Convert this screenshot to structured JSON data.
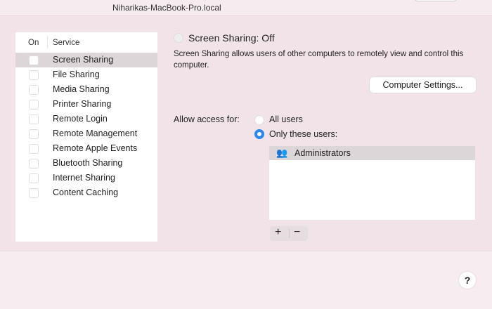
{
  "window": {
    "hostname": "Niharikas-MacBook-Pro.local"
  },
  "services": {
    "col_on": "On",
    "col_service": "Service",
    "items": [
      {
        "label": "Screen Sharing",
        "on": false,
        "selected": true
      },
      {
        "label": "File Sharing",
        "on": false
      },
      {
        "label": "Media Sharing",
        "on": false
      },
      {
        "label": "Printer Sharing",
        "on": false
      },
      {
        "label": "Remote Login",
        "on": false
      },
      {
        "label": "Remote Management",
        "on": false
      },
      {
        "label": "Remote Apple Events",
        "on": false
      },
      {
        "label": "Bluetooth Sharing",
        "on": false
      },
      {
        "label": "Internet Sharing",
        "on": false
      },
      {
        "label": "Content Caching",
        "on": false
      }
    ]
  },
  "detail": {
    "status": "Screen Sharing: Off",
    "description": "Screen Sharing allows users of other computers to remotely view and control this computer.",
    "computer_settings": "Computer Settings...",
    "allow_label": "Allow access for:",
    "opt_all": "All users",
    "opt_only": "Only these users:",
    "selected_option": "Only these users:",
    "users": [
      "Administrators"
    ],
    "add": "+",
    "remove": "−",
    "help": "?"
  },
  "colors": {
    "accent": "#2a86f0",
    "selection": "#ddd6d9"
  }
}
